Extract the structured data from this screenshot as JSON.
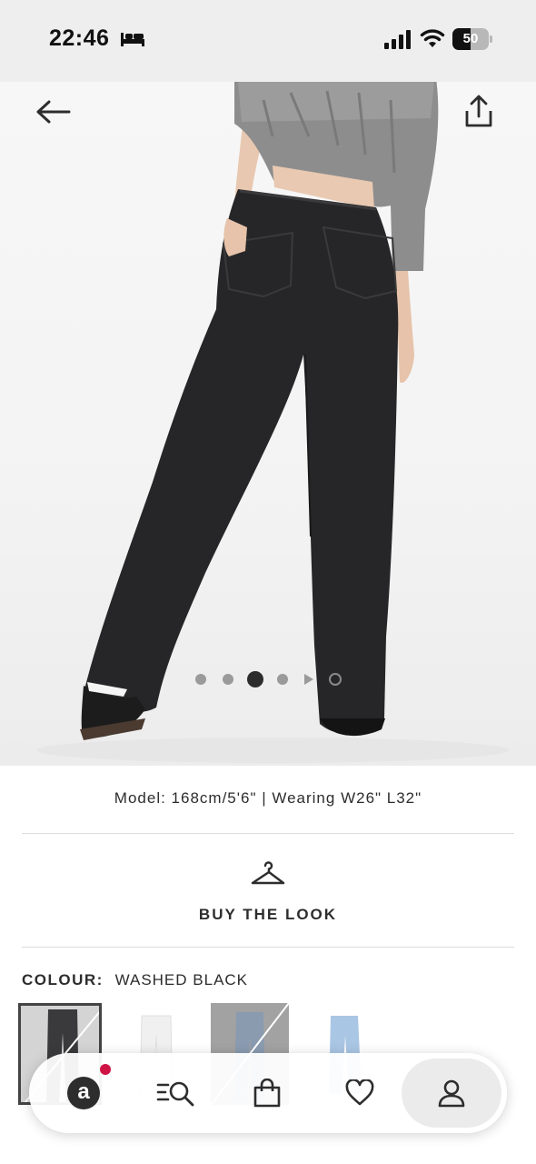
{
  "status_bar": {
    "time": "22:46",
    "battery_level": "50",
    "battery_fraction": 0.5
  },
  "icons": {
    "back": "back-arrow-icon",
    "share": "share-icon",
    "hanger": "hanger-icon",
    "home": "asos-logo-icon",
    "search": "search-icon",
    "bag": "bag-icon",
    "saved": "heart-icon",
    "account": "user-icon"
  },
  "product": {
    "carousel": {
      "active_index": 2
    },
    "model_info": "Model: 168cm/5'6\" | Wearing W26\" L32\"",
    "buy_the_look": "BUY THE LOOK",
    "colour": {
      "label": "COLOUR:",
      "value": "WASHED BLACK"
    },
    "swatches": [
      {
        "name": "washed black",
        "color": "#3a3a3c",
        "selected": true,
        "unavailable": true
      },
      {
        "name": "white",
        "color": "#f4f4f4",
        "selected": false,
        "unavailable": false
      },
      {
        "name": "grey blue",
        "color": "#8a9bb0",
        "selected": false,
        "unavailable": true
      },
      {
        "name": "light blue",
        "color": "#a9c6e4",
        "selected": false,
        "unavailable": false
      }
    ]
  },
  "bottom_nav": {
    "logo_letter": "a",
    "has_notification": true
  },
  "colors": {
    "text": "#2d2d2d",
    "notification": "#d01345",
    "status_bar_bg": "#eeeeee"
  }
}
